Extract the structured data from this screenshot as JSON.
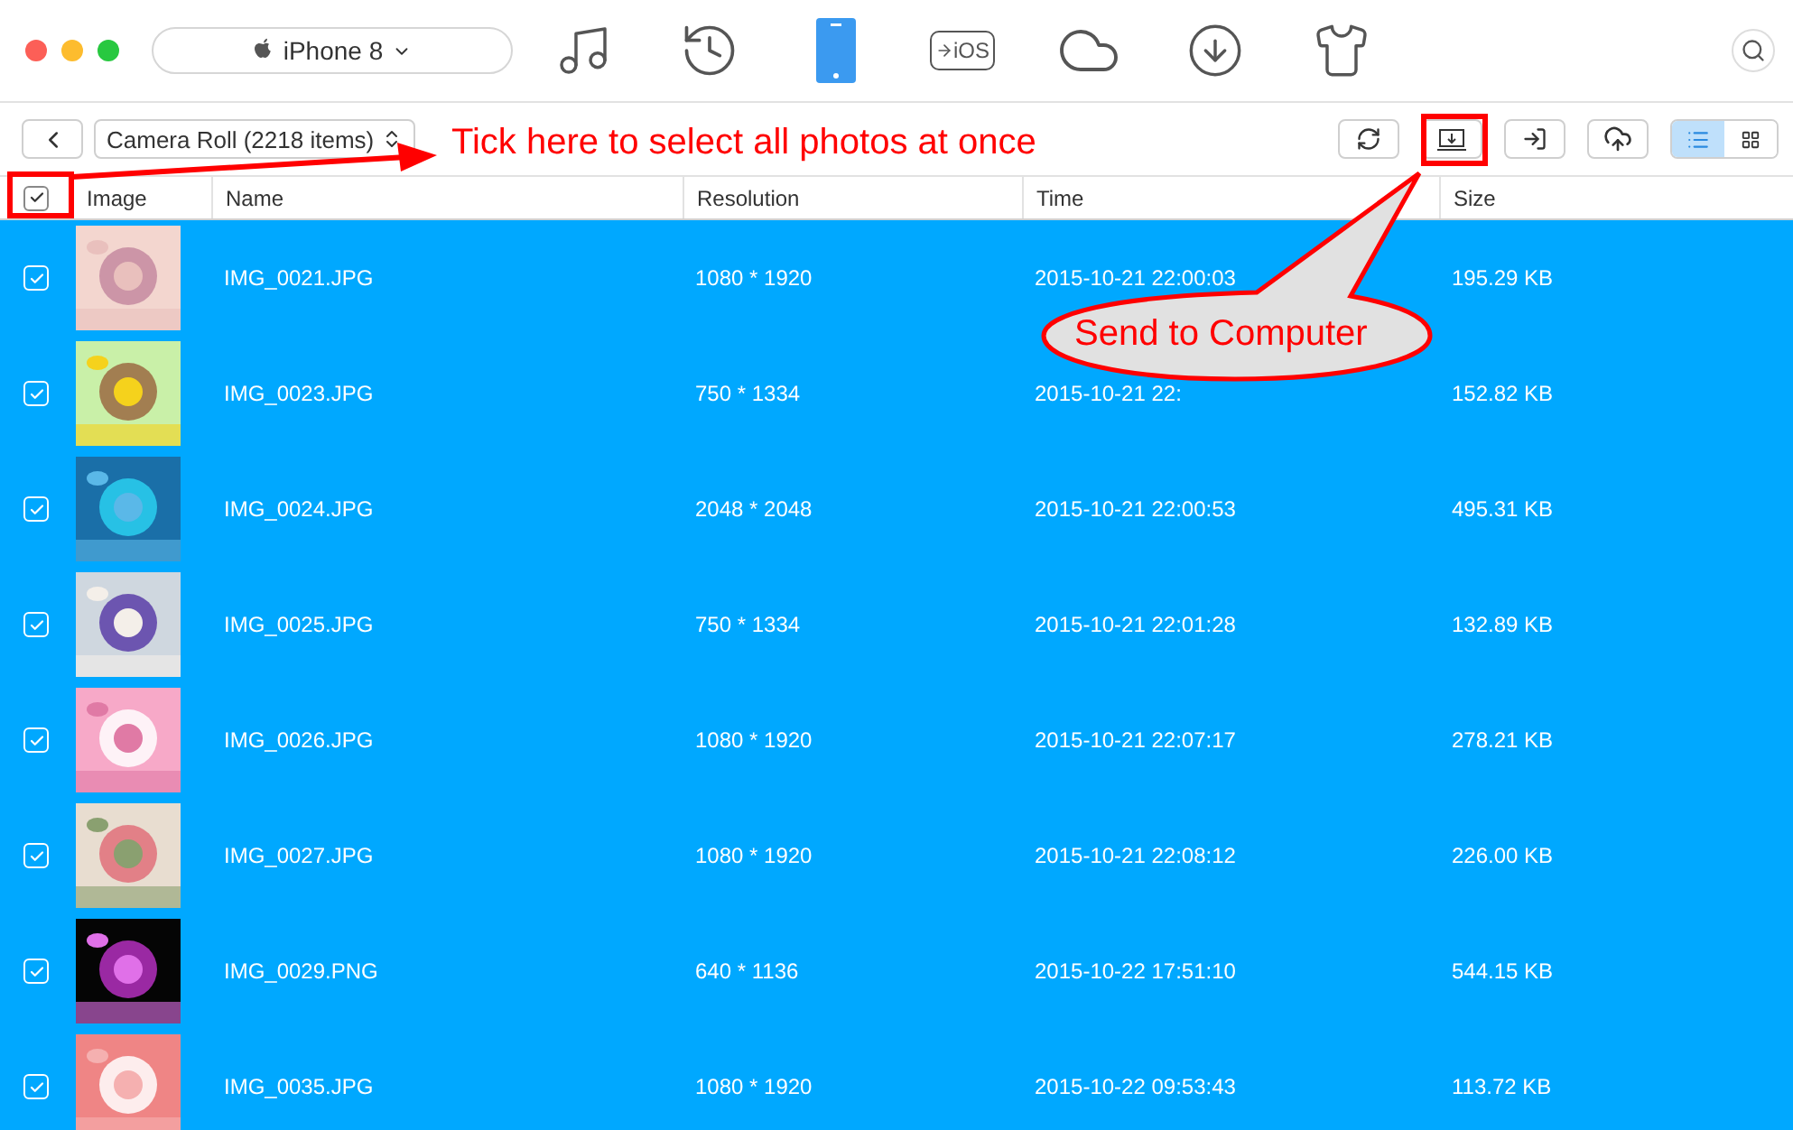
{
  "window": {
    "device": "iPhone 8"
  },
  "nav": [
    {
      "kind": "music",
      "selected": false
    },
    {
      "kind": "history",
      "selected": false
    },
    {
      "kind": "phone",
      "selected": true
    },
    {
      "kind": "ios",
      "label": "iOS",
      "selected": false
    },
    {
      "kind": "cloud",
      "selected": false
    },
    {
      "kind": "download",
      "selected": false
    },
    {
      "kind": "shirt",
      "selected": false
    }
  ],
  "toolbar": {
    "album": "Camera Roll (2218 items)",
    "views": [
      {
        "kind": "list",
        "selected": true
      },
      {
        "kind": "grid",
        "selected": false
      }
    ]
  },
  "table": {
    "all_checked": true,
    "columns": [
      "Image",
      "Name",
      "Resolution",
      "Time",
      "Size"
    ],
    "rows": [
      {
        "checked": true,
        "selected": true,
        "name": "IMG_0021.JPG",
        "resolution": "1080 * 1920",
        "time": "2015-10-21 22:00:03",
        "size": "195.29 KB"
      },
      {
        "checked": true,
        "selected": true,
        "name": "IMG_0023.JPG",
        "resolution": "750 * 1334",
        "time": "2015-10-21 22:",
        "size": "152.82 KB"
      },
      {
        "checked": true,
        "selected": true,
        "name": "IMG_0024.JPG",
        "resolution": "2048 * 2048",
        "time": "2015-10-21 22:00:53",
        "size": "495.31 KB"
      },
      {
        "checked": true,
        "selected": true,
        "name": "IMG_0025.JPG",
        "resolution": "750 * 1334",
        "time": "2015-10-21 22:01:28",
        "size": "132.89 KB"
      },
      {
        "checked": true,
        "selected": true,
        "name": "IMG_0026.JPG",
        "resolution": "1080 * 1920",
        "time": "2015-10-21 22:07:17",
        "size": "278.21 KB"
      },
      {
        "checked": true,
        "selected": true,
        "name": "IMG_0027.JPG",
        "resolution": "1080 * 1920",
        "time": "2015-10-21 22:08:12",
        "size": "226.00 KB"
      },
      {
        "checked": true,
        "selected": true,
        "name": "IMG_0029.PNG",
        "resolution": "640 * 1136",
        "time": "2015-10-22 17:51:10",
        "size": "544.15 KB"
      },
      {
        "checked": true,
        "selected": true,
        "name": "IMG_0035.JPG",
        "resolution": "1080 * 1920",
        "time": "2015-10-22 09:53:43",
        "size": "113.72 KB"
      }
    ]
  },
  "annotations": [
    {
      "kind": "note",
      "text": "Tick here to select all photos at once"
    },
    {
      "kind": "callout",
      "text": "Send to Computer"
    }
  ]
}
